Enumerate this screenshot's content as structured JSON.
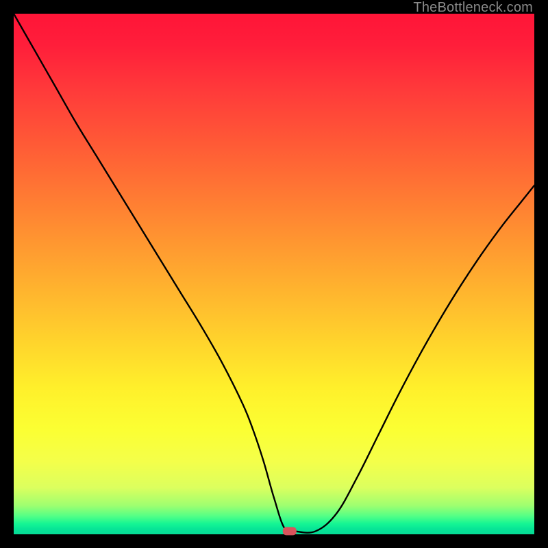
{
  "watermark": "TheBottleneck.com",
  "chart_data": {
    "type": "line",
    "title": "",
    "xlabel": "",
    "ylabel": "",
    "xlim": [
      0,
      100
    ],
    "ylim": [
      0,
      100
    ],
    "series": [
      {
        "name": "bottleneck-curve",
        "x": [
          0,
          4,
          8,
          12,
          16,
          20,
          24,
          28,
          32,
          36,
          40,
          44,
          46,
          48,
          50,
          52,
          54,
          58,
          62,
          66,
          70,
          74,
          78,
          82,
          86,
          90,
          94,
          98,
          100
        ],
        "y": [
          100,
          93,
          86,
          79,
          72.5,
          66,
          59.5,
          53,
          46.5,
          40,
          33,
          25,
          20,
          14,
          7,
          1.2,
          0.6,
          0.6,
          4,
          11,
          19,
          27,
          34.5,
          41.5,
          48,
          54,
          59.5,
          64.5,
          67
        ]
      }
    ],
    "marker": {
      "x": 53,
      "y": 0.6,
      "shape": "rounded-rect",
      "color": "#d9535c"
    },
    "background_gradient": {
      "stops": [
        {
          "pos": 0,
          "color": "#ff1538"
        },
        {
          "pos": 0.55,
          "color": "#ffba2e"
        },
        {
          "pos": 0.8,
          "color": "#fbff33"
        },
        {
          "pos": 0.965,
          "color": "#54ff86"
        },
        {
          "pos": 1.0,
          "color": "#05db96"
        }
      ]
    }
  }
}
